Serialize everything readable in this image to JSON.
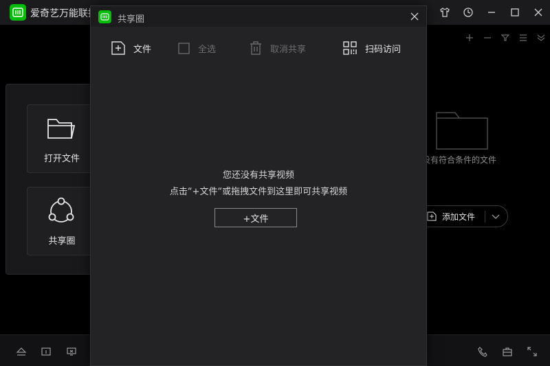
{
  "app": {
    "title": "爱奇艺万能联播",
    "brand_color": "#00be06"
  },
  "window_controls": [
    "shirt-icon",
    "clock-icon",
    "minimize-icon",
    "maximize-icon",
    "close-icon"
  ],
  "left_cards": {
    "open_file": "打开文件",
    "share_circle": "共享圈"
  },
  "main_area": {
    "empty_text": "没有符合条件的文件",
    "add_file": "添加文件"
  },
  "modal": {
    "title": "共享圈",
    "toolbar": {
      "file": "文件",
      "select_all": "全选",
      "cancel_share": "取消共享",
      "scan_access": "扫码访问"
    },
    "empty_line1": "您还没有共享视频",
    "empty_line2": "点击“+文件“或拖拽文件到这里即可共享视频",
    "add_button": "+文件"
  }
}
